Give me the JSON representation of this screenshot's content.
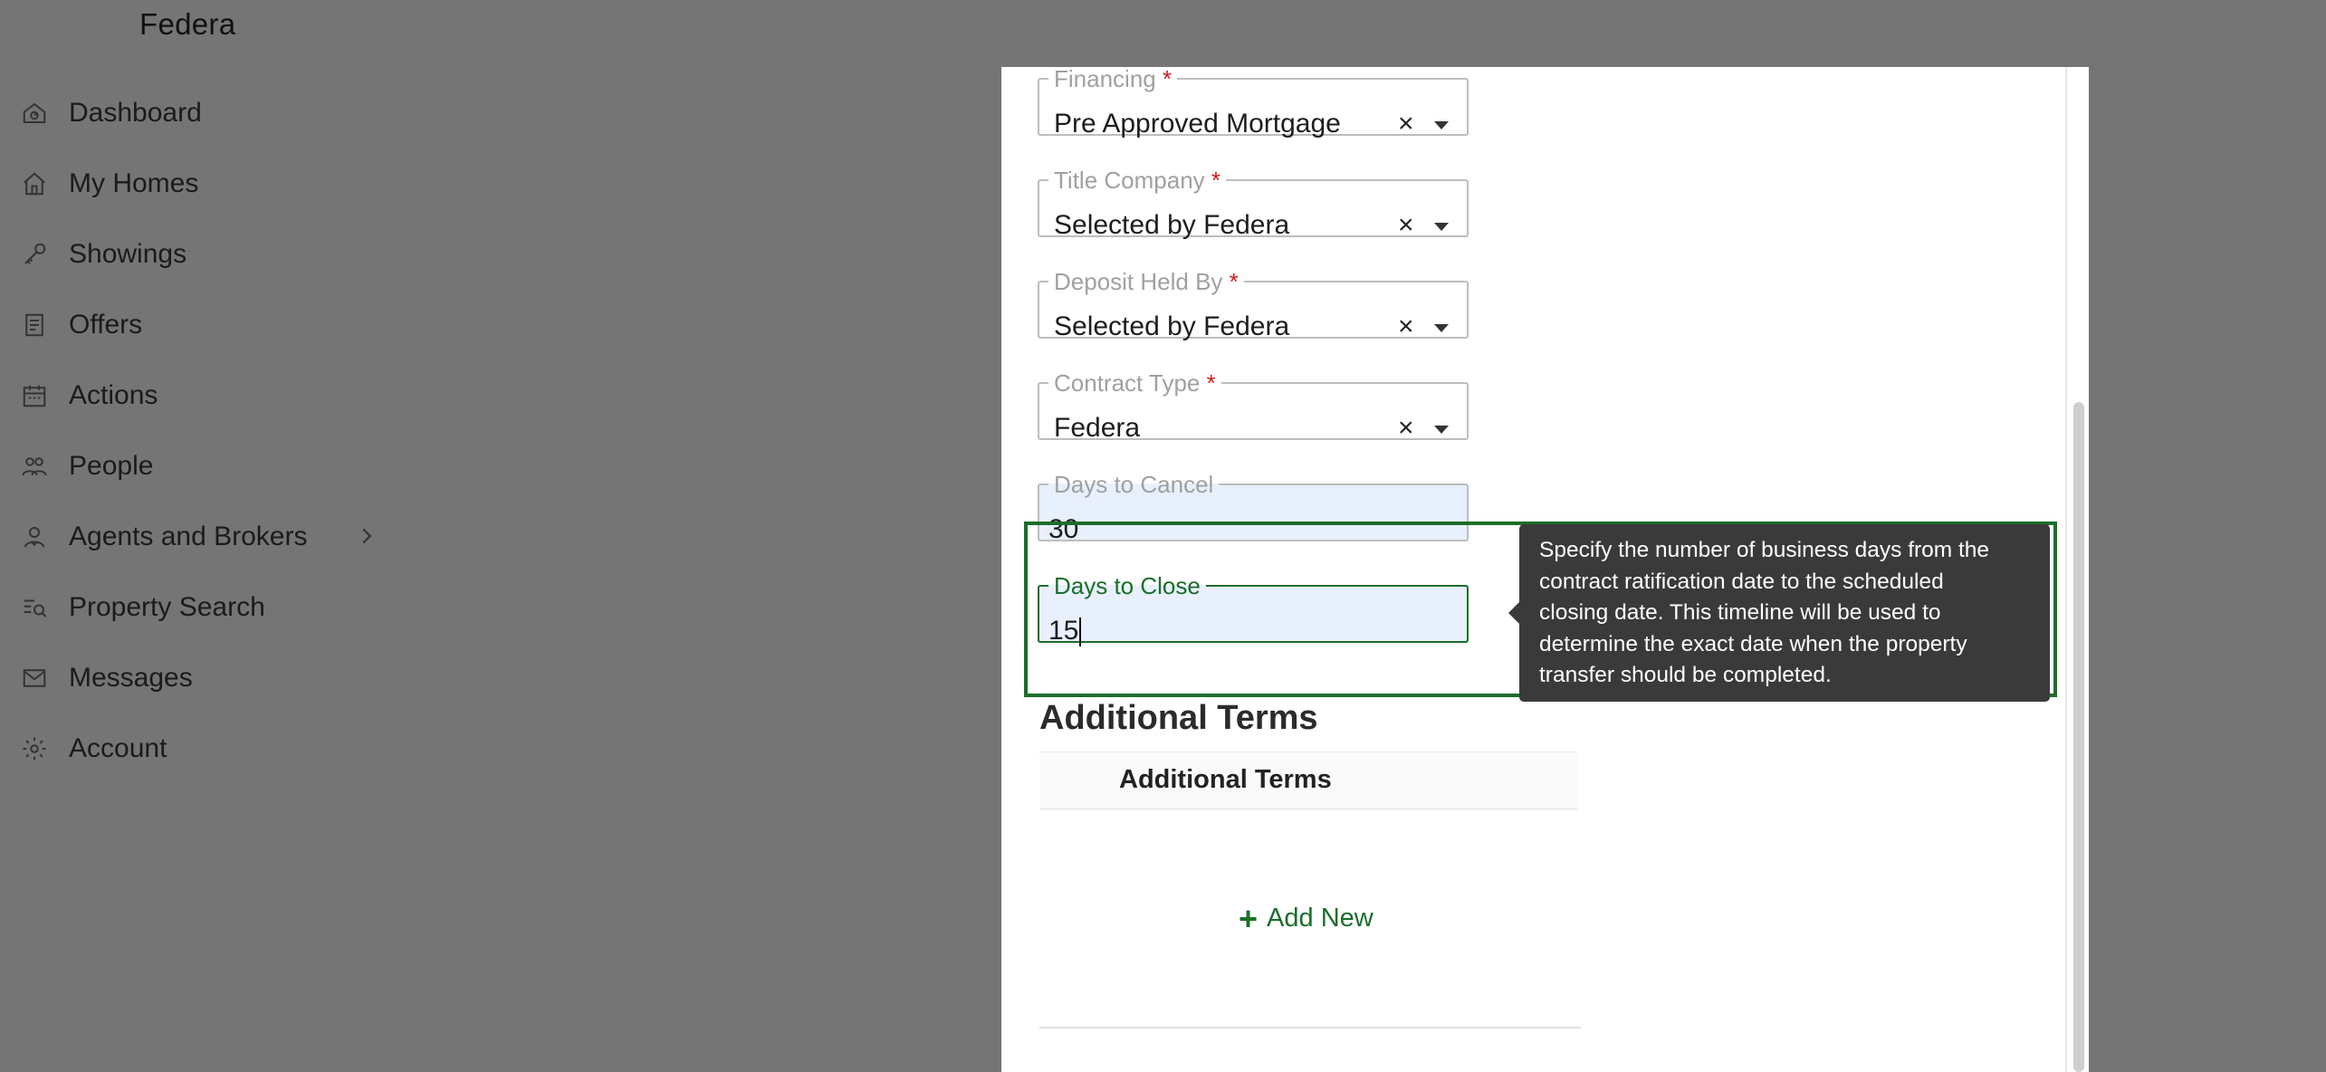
{
  "app": {
    "brand": "Federa"
  },
  "sidebar": {
    "items": [
      {
        "label": "Dashboard",
        "icon": "dashboard-icon"
      },
      {
        "label": "My Homes",
        "icon": "home-icon"
      },
      {
        "label": "Showings",
        "icon": "key-icon"
      },
      {
        "label": "Offers",
        "icon": "document-icon"
      },
      {
        "label": "Actions",
        "icon": "calendar-icon"
      },
      {
        "label": "People",
        "icon": "people-icon"
      },
      {
        "label": "Agents and Brokers",
        "icon": "agent-icon",
        "has_submenu": true
      },
      {
        "label": "Property Search",
        "icon": "search-list-icon"
      },
      {
        "label": "Messages",
        "icon": "mail-icon"
      },
      {
        "label": "Account",
        "icon": "gear-icon"
      }
    ]
  },
  "form": {
    "financing": {
      "label": "Financing",
      "required_mark": "*",
      "value": "Pre Approved Mortgage",
      "clear": "×"
    },
    "title_company": {
      "label": "Title Company",
      "required_mark": "*",
      "value": "Selected by Federa",
      "clear": "×"
    },
    "deposit_held_by": {
      "label": "Deposit Held By",
      "required_mark": "*",
      "value": "Selected by Federa",
      "clear": "×"
    },
    "contract_type": {
      "label": "Contract Type",
      "required_mark": "*",
      "value": "Federa",
      "clear": "×"
    },
    "days_to_cancel": {
      "label": "Days to Cancel",
      "value": "30"
    },
    "days_to_close": {
      "label": "Days to Close",
      "value": "15"
    }
  },
  "tooltip": {
    "lines": [
      "Specify the number of business days from the",
      "contract ratification date to the scheduled",
      "closing date. This timeline will be used to",
      "determine the exact date when the property",
      "transfer should be completed."
    ]
  },
  "additional_terms": {
    "heading": "Additional Terms",
    "column_header": "Additional Terms",
    "add_new": "Add New",
    "add_icon": "plus-icon"
  },
  "colors": {
    "accent": "#1b6e2a",
    "overlay": "#757575",
    "tooltip_bg": "#3a3a3a",
    "required": "#d11919",
    "input_fill": "#e8f0fe"
  }
}
